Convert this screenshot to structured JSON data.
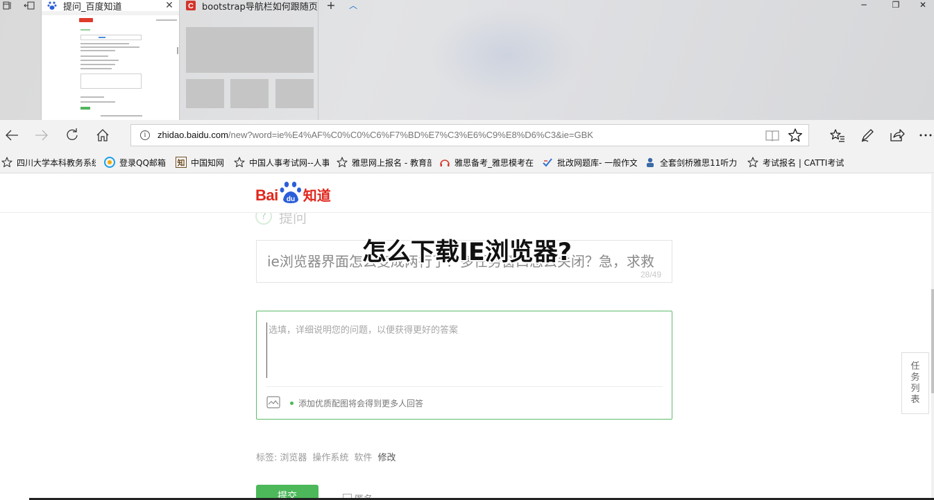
{
  "tabs": [
    {
      "title": "提问_百度知道",
      "active": true,
      "favicon": "baidu-paw-icon",
      "close": "✕"
    },
    {
      "title": "bootstrap导航栏如何跟随页",
      "active": false,
      "favicon": "csdn-c-icon"
    }
  ],
  "tabstrip": {
    "new_tab": "+",
    "show_previews": "︿"
  },
  "window": {
    "minimize": "─",
    "maximize": "❐",
    "close": "✕"
  },
  "address_bar": {
    "host": "zhidao.baidu.com",
    "path": "/new?word=ie%E4%AF%C0%C0%C6%F7%BD%E7%C3%E6%C9%E8%D6%C3&ie=GBK"
  },
  "favorites": [
    {
      "label": "四川大学本科教务系统",
      "icon": "star-icon"
    },
    {
      "label": "登录QQ邮箱",
      "icon": "qq-mail-icon"
    },
    {
      "label": "中国知网",
      "icon": "cnki-icon"
    },
    {
      "label": "中国人事考试网--人事",
      "icon": "star-icon"
    },
    {
      "label": "雅思网上报名 - 教育部",
      "icon": "star-icon"
    },
    {
      "label": "雅思备考_雅思模考在",
      "icon": "headphones-icon"
    },
    {
      "label": "批改网题库- 一般作文",
      "icon": "check-icon"
    },
    {
      "label": "全套剑桥雅思11听力",
      "icon": "person-icon"
    },
    {
      "label": "考试报名 | CATTI考试",
      "icon": "star-icon"
    }
  ],
  "page": {
    "logo": {
      "bai": "Bai",
      "du": "du",
      "zhidao": "知道"
    },
    "ask_heading": "提问",
    "ask_icon": "?",
    "overlay_title": "怎么下载IE浏览器?",
    "question": {
      "text": "ie浏览器界面怎么变成两行了？多任务窗口怎么关闭？急，求救",
      "count": "28/49"
    },
    "detail": {
      "placeholder": "选填，详细说明您的问题，以便获得更好的答案",
      "hint": "添加优质配图将会得到更多人回答"
    },
    "tags": {
      "label": "标签:",
      "items": [
        "浏览器",
        "操作系统",
        "软件"
      ],
      "modify": "修改"
    },
    "submit": "提交",
    "anonymous": "匿名",
    "task_list": [
      "任",
      "务",
      "列",
      "表"
    ]
  },
  "colors": {
    "baidu_red": "#e1261c",
    "baidu_blue": "#2b5fd9",
    "zhidao_green": "#4cb85a",
    "edge_link": "#1a6fd0"
  }
}
